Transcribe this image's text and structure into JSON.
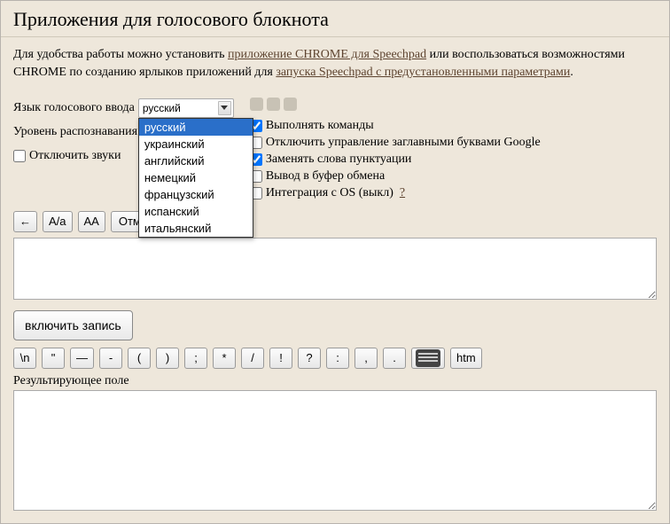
{
  "title": "Приложения для голосового блокнота",
  "intro": {
    "part1": "Для удобства работы можно установить ",
    "link1": "приложение CHROME для Speechpad",
    "part2": " или воспользоваться возможностями CHROME по созданию ярлыков приложений для ",
    "link2": "запуска Speechpad с предустановленными параметрами",
    "part3": "."
  },
  "settings": {
    "voice_lang_label": "Язык голосового ввода",
    "recog_level_label": "Уровень распознавания",
    "mute_sounds_label": "Отключить звуки",
    "mute_sounds_checked": false,
    "lang_selected": "русский",
    "lang_options": [
      "русский",
      "украинский",
      "английский",
      "немецкий",
      "французский",
      "испанский",
      "итальянский"
    ]
  },
  "checks": {
    "run_commands": {
      "label": "Выполнять команды",
      "checked": true
    },
    "disable_caps": {
      "label": "Отключить управление заглавными буквами Google",
      "checked": false
    },
    "replace_punct": {
      "label": "Заменять слова пунктуации",
      "checked": true
    },
    "buffer_out": {
      "label": "Вывод в буфер обмена",
      "checked": false
    },
    "os_integration": {
      "label": "Интеграция с OS (выкл)",
      "checked": false,
      "help": "?"
    }
  },
  "toolbar": {
    "back": "←",
    "case1": "A/a",
    "case2": "AA",
    "undo": "Отменить"
  },
  "record_label": "включить запись",
  "punct": [
    "\\n",
    "\"",
    "—",
    "-",
    "(",
    ")",
    ";",
    "*",
    "/",
    "!",
    "?",
    ":",
    ",",
    "."
  ],
  "htm_btn": "htm",
  "result_label": "Результирующее поле"
}
